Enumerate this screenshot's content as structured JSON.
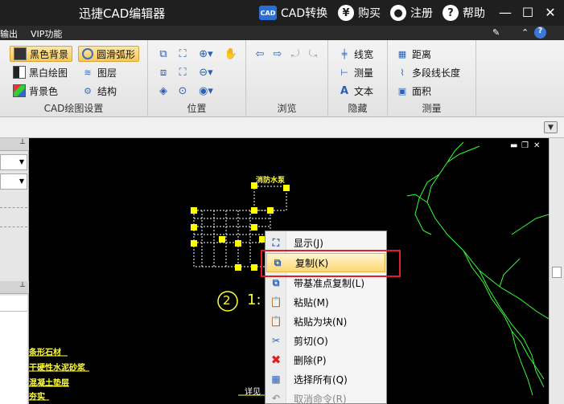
{
  "app": {
    "title": "迅捷CAD编辑器",
    "titlebar_buttons": [
      {
        "label": "CAD转换",
        "icon": "cad-icon"
      },
      {
        "label": "购买",
        "icon": "yen-icon"
      },
      {
        "label": "注册",
        "icon": "user-icon"
      },
      {
        "label": "帮助",
        "icon": "help-icon"
      }
    ]
  },
  "menubar": {
    "items": [
      "输出",
      "VIP功能"
    ]
  },
  "ribbon": {
    "groups": {
      "cad_settings": {
        "label": "CAD绘图设置",
        "buttons": [
          "黑色背景",
          "圆滑弧形",
          "黑白绘图",
          "图层",
          "背景色",
          "结构"
        ]
      },
      "position": {
        "label": "位置"
      },
      "browse": {
        "label": "浏览"
      },
      "hide": {
        "label": "隐藏",
        "buttons": [
          "线宽",
          "测量",
          "文本"
        ]
      },
      "measure": {
        "label": "测量",
        "buttons": [
          "距离",
          "多段线长度",
          "面积"
        ]
      }
    }
  },
  "drawing": {
    "circled_number": "2",
    "scale_fragment": "1:",
    "top_label": "消防水泵",
    "bottom_label": "详见",
    "left_annotations": [
      "条形石材",
      "干硬性水泥砂浆",
      "混凝土垫层",
      "夯实"
    ],
    "colors": {
      "lines": "#33ff33",
      "grips": "#ffff00",
      "text": "#ffff3a"
    }
  },
  "context_menu": {
    "items": [
      {
        "label": "显示(J)",
        "icon": "zoom-extents-icon",
        "state": "normal"
      },
      {
        "label": "复制(K)",
        "icon": "copy-icon",
        "state": "highlighted"
      },
      {
        "label": "带基准点复制(L)",
        "icon": "copy-basepoint-icon",
        "state": "normal"
      },
      {
        "label": "粘贴(M)",
        "icon": "paste-icon",
        "state": "normal"
      },
      {
        "label": "粘贴为块(N)",
        "icon": "paste-block-icon",
        "state": "normal"
      },
      {
        "label": "剪切(O)",
        "icon": "scissors-icon",
        "state": "normal"
      },
      {
        "label": "删除(P)",
        "icon": "delete-x-icon",
        "state": "normal"
      },
      {
        "label": "选择所有(Q)",
        "icon": "select-all-icon",
        "state": "normal"
      },
      {
        "label": "取消命令(R)",
        "icon": "undo-icon",
        "state": "disabled"
      }
    ]
  }
}
